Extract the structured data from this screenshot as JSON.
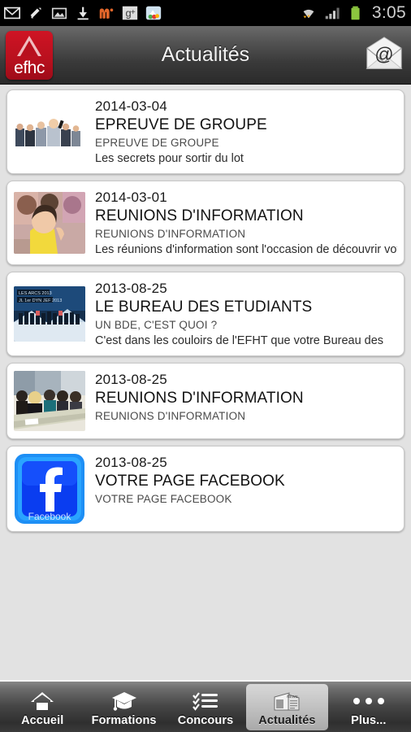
{
  "statusbar": {
    "time": "3:05",
    "left_icons": [
      "gmail-icon",
      "sync-icon",
      "photo-icon",
      "download-icon",
      "m-app-icon",
      "google-plus-icon",
      "gallery-app-icon"
    ],
    "right_icons": [
      "wifi-icon",
      "signal-icon",
      "battery-icon"
    ],
    "battery_color": "#8cc63f"
  },
  "header": {
    "logo_text": "efhc",
    "logo_color": "#b8101e",
    "title": "Actualités",
    "mail_icon": "envelope-at-icon"
  },
  "list": {
    "items": [
      {
        "date": "2014-03-04",
        "title": "EPREUVE DE GROUPE",
        "subtitle": "EPREUVE DE GROUPE",
        "description": "Les secrets pour sortir du lot",
        "thumb": "group-of-people-photo"
      },
      {
        "date": "2014-03-01",
        "title": "REUNIONS D'INFORMATION",
        "subtitle": "REUNIONS D'INFORMATION",
        "description": "Les réunions d'information sont l'occasion de découvrir votre",
        "thumb": "audience-woman-yellow-photo"
      },
      {
        "date": "2013-08-25",
        "title": "LE BUREAU DES ETUDIANTS",
        "subtitle": "UN BDE, C'EST QUOI ?",
        "description": "C'est dans les couloirs de l'EFHT que votre Bureau des",
        "thumb": "ski-trip-group-photo"
      },
      {
        "date": "2013-08-25",
        "title": "REUNIONS D'INFORMATION",
        "subtitle": "REUNIONS D'INFORMATION",
        "description": "",
        "thumb": "classroom-students-photo"
      },
      {
        "date": "2013-08-25",
        "title": "VOTRE PAGE FACEBOOK",
        "subtitle": "VOTRE PAGE FACEBOOK",
        "description": "",
        "thumb": "facebook-logo-icon"
      }
    ]
  },
  "tabbar": {
    "tabs": [
      {
        "label": "Accueil",
        "icon": "home-icon",
        "active": false
      },
      {
        "label": "Formations",
        "icon": "graduation-cap-icon",
        "active": false
      },
      {
        "label": "Concours",
        "icon": "checklist-icon",
        "active": false
      },
      {
        "label": "Actualités",
        "icon": "newspaper-icon",
        "active": true
      },
      {
        "label": "Plus...",
        "icon": "more-dots-icon",
        "active": false
      }
    ]
  }
}
